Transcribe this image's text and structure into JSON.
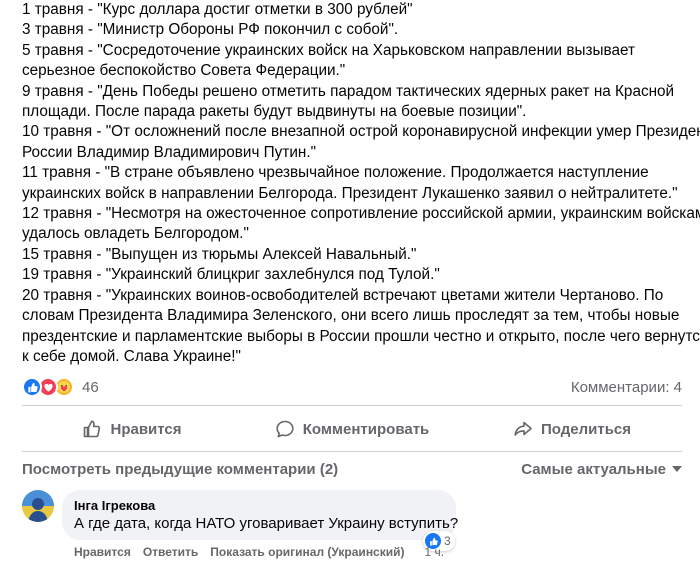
{
  "post": {
    "lines": [
      "1 травня - \"Курс доллара достиг отметки в 300 рублей\"",
      "3 травня - \"Министр Обороны РФ покончил с собой\".",
      "5 травня - \"Сосредоточение украинских войск на Харьковском направлении вызывает",
      "серьезное беспокойство Совета Федерации.\"",
      "9 травня - \"День Победы решено отметить парадом тактических ядерных ракет на Красной",
      "площади. После парада ракеты будут выдвинуты на боевые позиции\".",
      "10 травня - \"От осложнений после внезапной острой коронавирусной инфекции умер Президент",
      "России Владимир Владимирович Путин.\"",
      "11 травня - \"В стране объявлено чрезвычайное положение. Продолжается наступление",
      "украинских войск в направлении Белгорода. Президент Лукашенко заявил о нейтралитете.\"",
      "12 травня - \"Несмотря на ожесточенное сопротивление российской армии, украинским войскам",
      "удалось овладеть Белгородом.\"",
      "15 травня - \"Выпущен из тюрьмы Алексей Навальный.\"",
      "19 травня - \"Украинский блицкриг захлебнулся под Тулой.\"",
      "20 травня - \"Украинских воинов-освободителей встречают цветами жители Чертаново. По",
      "словам Президента Владимира Зеленского, они всего лишь проследят за тем, чтобы новые",
      "прездентские и парламентские выборы в России прошли честно и открыто, после чего вернутся",
      "к себе домой. Слава Украине!\""
    ]
  },
  "reactions": {
    "icons": [
      "like-icon",
      "love-icon",
      "care-icon"
    ],
    "count": "46",
    "comments_count": "Комментарии: 4"
  },
  "actions": {
    "like_label": "Нравится",
    "comment_label": "Комментировать",
    "share_label": "Поделиться"
  },
  "comments_section": {
    "previous_label": "Посмотреть предыдущие комментарии (2)",
    "sort_label": "Самые актуальные"
  },
  "comment": {
    "author": "Інга Ігрекова",
    "text": "А где дата, когда НАТО уговаривает Украину вступить?",
    "reaction_count": "3",
    "like_action": "Нравится",
    "reply_action": "Ответить",
    "translate_action": "Показать оригинал (Украинский)",
    "timestamp": "1 ч."
  },
  "colors": {
    "accent": "#1877f2",
    "secondary_text": "#65676b",
    "bubble_bg": "#f0f2f5",
    "divider": "#ced0d4"
  }
}
